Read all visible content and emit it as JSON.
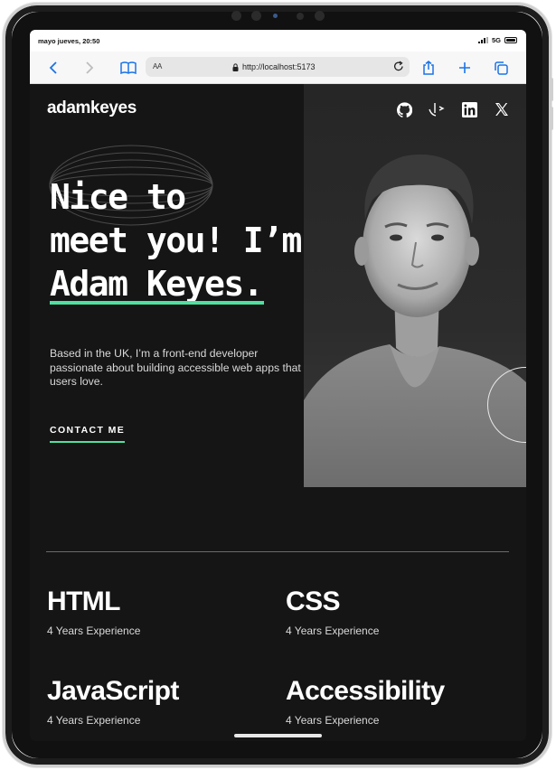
{
  "status_bar": {
    "time": "mayo jueves, 20:50",
    "network": "5G"
  },
  "browser": {
    "text_size_label": "AA",
    "url": "http://localhost:5173"
  },
  "site": {
    "logo": "adamkeyes",
    "socials": [
      "github-icon",
      "frontend-mentor-icon",
      "linkedin-icon",
      "x-icon"
    ],
    "accent_color": "#4ee1a0",
    "background_color": "#151515"
  },
  "hero": {
    "headline_line1": "Nice to",
    "headline_line2": "meet you! I’m",
    "headline_name": "Adam Keyes.",
    "intro": "Based in the UK, I’m a front-end developer passionate about building accessible web apps that users love.",
    "cta": "CONTACT ME"
  },
  "skills": [
    {
      "name": "HTML",
      "experience": "4 Years Experience"
    },
    {
      "name": "CSS",
      "experience": "4 Years Experience"
    },
    {
      "name": "JavaScript",
      "experience": "4 Years Experience"
    },
    {
      "name": "Accessibility",
      "experience": "4 Years Experience"
    }
  ]
}
